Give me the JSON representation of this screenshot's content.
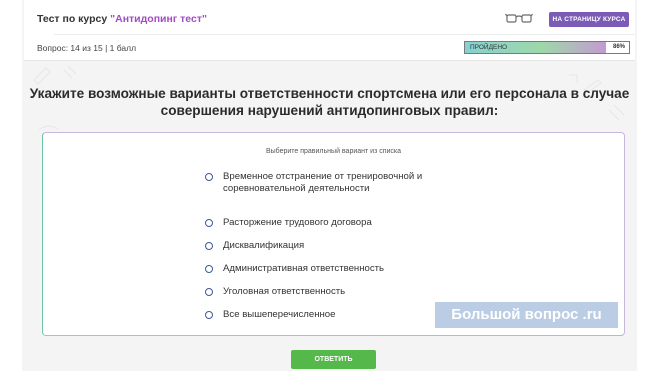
{
  "header": {
    "course_prefix": "Тест по курсу ",
    "course_name": "\"Антидопинг тест\"",
    "course_page_button": "НА СТРАНИЦУ КУРСА",
    "question_info": "Вопрос: 14 из 15 | 1 балл",
    "progress_label": "ПРОЙДЕНО",
    "progress_percent": "86%",
    "progress_value": 0.86
  },
  "question": {
    "text": "Укажите возможные варианты ответственности спортсмена или его персонала в случае совершения нарушений антидопинговых правил:",
    "instruction": "Выберите правильный вариант из списка",
    "options": [
      "Временное отстранение от тренировочной и соревновательной деятельности",
      "Расторжение трудового договора",
      "Дисквалификация",
      "Административная ответственность",
      "Уголовная ответственность",
      "Все вышеперечисленное"
    ]
  },
  "watermark": "Большой вопрос .ru",
  "submit_button": "ОТВЕТИТЬ",
  "colors": {
    "accent_purple": "#7b5bb6",
    "course_name": "#a24bc4",
    "submit_green": "#55b84a"
  },
  "icons": [
    "glasses-icon"
  ]
}
